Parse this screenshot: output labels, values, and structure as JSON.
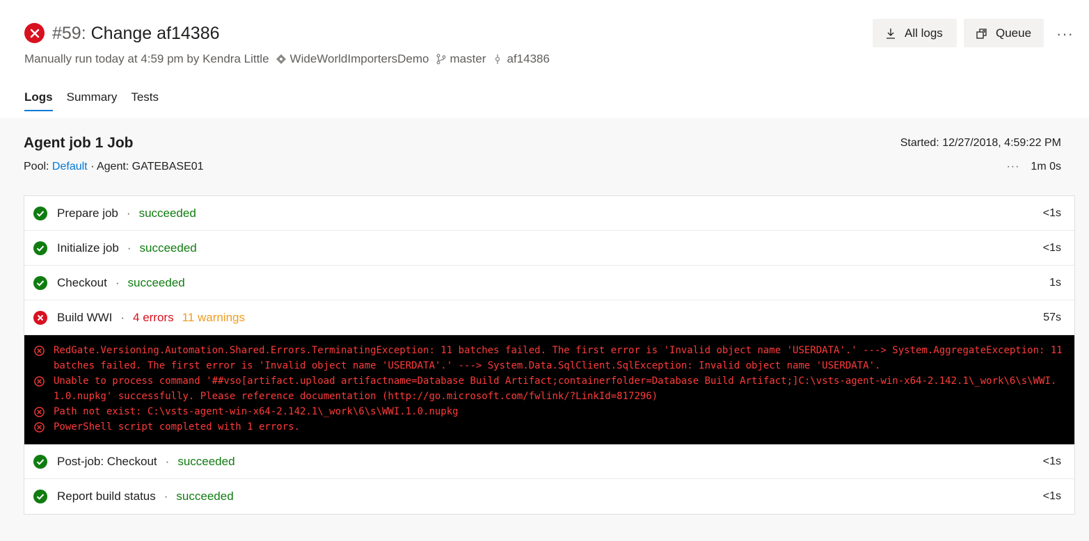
{
  "header": {
    "run_number": "#59:",
    "run_name": "Change af14386",
    "subtitle": "Manually run today at 4:59 pm by Kendra Little",
    "repo": "WideWorldImportersDemo",
    "branch": "master",
    "commit": "af14386",
    "all_logs_label": "All logs",
    "queue_label": "Queue",
    "more_label": "···"
  },
  "tabs": [
    {
      "label": "Logs",
      "active": true
    },
    {
      "label": "Summary",
      "active": false
    },
    {
      "label": "Tests",
      "active": false
    }
  ],
  "job": {
    "title": "Agent job 1 Job",
    "pool_prefix": "Pool:",
    "pool_name": "Default",
    "agent": "· Agent: GATEBASE01",
    "started": "Started: 12/27/2018, 4:59:22 PM",
    "more": "···",
    "duration": "1m 0s"
  },
  "steps": [
    {
      "name": "Prepare job",
      "status": "succeeded",
      "duration": "<1s"
    },
    {
      "name": "Initialize job",
      "status": "succeeded",
      "duration": "<1s"
    },
    {
      "name": "Checkout",
      "status": "succeeded",
      "duration": "1s"
    },
    {
      "name": "Build WWI",
      "errors": "4 errors",
      "warnings": "11 warnings",
      "duration": "57s"
    },
    {
      "name": "Post-job: Checkout",
      "status": "succeeded",
      "duration": "<1s"
    },
    {
      "name": "Report build status",
      "status": "succeeded",
      "duration": "<1s"
    }
  ],
  "separator": "·",
  "log_lines": [
    "RedGate.Versioning.Automation.Shared.Errors.TerminatingException: 11 batches failed. The first error is 'Invalid object name 'USERDATA'.' ---> System.AggregateException: 11 batches failed. The first error is 'Invalid object name 'USERDATA'.' ---> System.Data.SqlClient.SqlException: Invalid object name 'USERDATA'.",
    "Unable to process command '##vso[artifact.upload artifactname=Database Build Artifact;containerfolder=Database Build Artifact;]C:\\vsts-agent-win-x64-2.142.1\\_work\\6\\s\\WWI.1.0.nupkg' successfully. Please reference documentation (http://go.microsoft.com/fwlink/?LinkId=817296)",
    "Path not exist: C:\\vsts-agent-win-x64-2.142.1\\_work\\6\\s\\WWI.1.0.nupkg",
    "PowerShell script completed with 1 errors."
  ],
  "colors": {
    "error": "#d9101f",
    "success": "#107c10",
    "warning": "#f29b1d",
    "link": "#0078d4",
    "log_text": "#ff3b3b"
  }
}
